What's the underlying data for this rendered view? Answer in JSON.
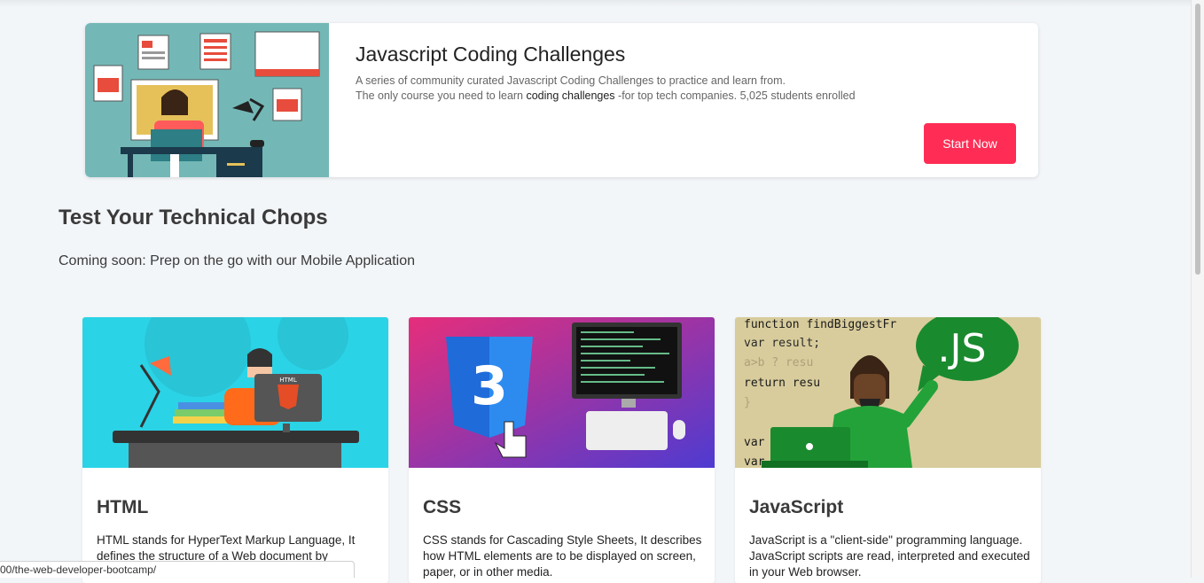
{
  "hero": {
    "title": "Javascript Coding Challenges",
    "line1": "A series of community curated Javascript Coding Challenges to practice and learn from.",
    "line2_pre": "The only course you need to learn ",
    "line2_bold": "coding challenges",
    "line2_post": " -for top tech companies. 5,025 students enrolled",
    "button": "Start Now"
  },
  "section": {
    "title": "Test Your Technical Chops",
    "subtitle": "Coming soon: Prep on the go with our Mobile Application"
  },
  "cards": [
    {
      "title": "HTML",
      "desc": "HTML stands for HyperText Markup Language, It defines the structure of a Web document by",
      "badge": "HTML"
    },
    {
      "title": "CSS",
      "desc": "CSS stands for Cascading Style Sheets, It describes how HTML elements are to be displayed on screen, paper, or in other media.",
      "badge": "3"
    },
    {
      "title": "JavaScript",
      "desc": "JavaScript is a \"client-side\" programming language. JavaScript scripts are read, interpreted and executed in your Web browser.",
      "badge": ".JS",
      "code": [
        "function findBiggestFr",
        "    var result;",
        "    a>b ? resu",
        "    return resu",
        "}",
        "var",
        "var s"
      ]
    }
  ],
  "status_url": "00/the-web-developer-bootcamp/",
  "colors": {
    "accent": "#ff2d55",
    "hero_bg": "#73b8b6",
    "html_bg": "#2ad3e6",
    "js_bg": "#d8cc9c"
  }
}
